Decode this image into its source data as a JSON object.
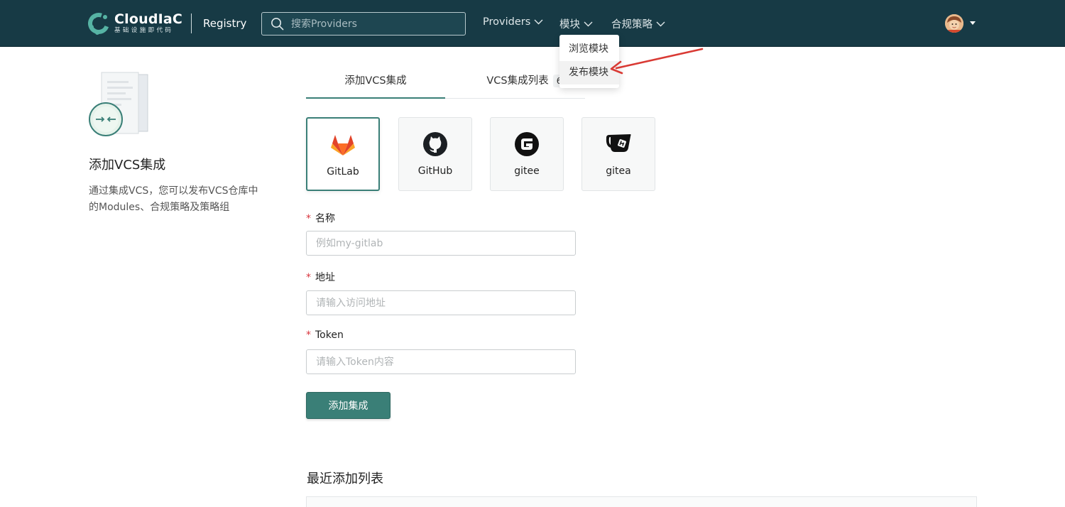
{
  "header": {
    "brand_name": "CloudIaC",
    "brand_sub": "基础设施即代码",
    "registry_label": "Registry",
    "search_placeholder": "搜索Providers",
    "nav": [
      {
        "label": "Providers"
      },
      {
        "label": "模块"
      },
      {
        "label": "合规策略"
      }
    ]
  },
  "dropdown": {
    "items": [
      {
        "label": "浏览模块"
      },
      {
        "label": "发布模块"
      }
    ],
    "highlighted": "发布模块"
  },
  "sidebar": {
    "title": "添加VCS集成",
    "description": "通过集成VCS，您可以发布VCS仓库中的Modules、合规策略及策略组"
  },
  "tabs": [
    {
      "label": "添加VCS集成"
    },
    {
      "label": "VCS集成列表",
      "badge": "6"
    }
  ],
  "vcs_options": [
    {
      "label": "GitLab",
      "icon": "gitlab-icon",
      "selected": true
    },
    {
      "label": "GitHub",
      "icon": "github-icon",
      "selected": false
    },
    {
      "label": "gitee",
      "icon": "gitee-icon",
      "selected": false
    },
    {
      "label": "gitea",
      "icon": "gitea-icon",
      "selected": false
    }
  ],
  "form": {
    "required_mark": "*",
    "name": {
      "label": "名称",
      "placeholder": "例如my-gitlab",
      "value": ""
    },
    "address": {
      "label": "地址",
      "placeholder": "请输入访问地址",
      "value": ""
    },
    "token": {
      "label": "Token",
      "placeholder": "请输入Token内容",
      "value": ""
    },
    "submit_label": "添加集成"
  },
  "recent": {
    "title": "最近添加列表"
  },
  "colors": {
    "header_bg": "#173a45",
    "accent": "#3a7f77",
    "required": "#d9363e",
    "annotation_arrow": "#d93a34"
  }
}
